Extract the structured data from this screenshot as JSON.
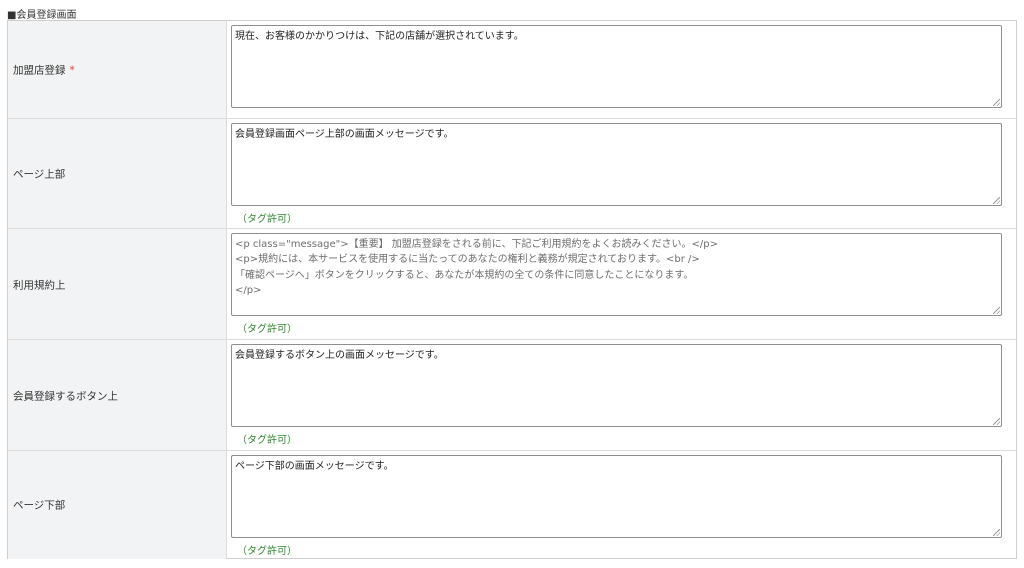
{
  "section": {
    "title": "■会員登録画面"
  },
  "rows": [
    {
      "label": "加盟店登録",
      "required_mark": "*",
      "value": "現在、お客様のかかりつけは、下記の店舗が選択されています。",
      "hint": ""
    },
    {
      "label": "ページ上部",
      "value": "会員登録画面ページ上部の画面メッセージです。",
      "hint": "（タグ許可）"
    },
    {
      "label": "利用規約上",
      "value": "<p class=\"message\">【重要】 加盟店登録をされる前に、下記ご利用規約をよくお読みください。</p>\n<p>規約には、本サービスを使用するに当たってのあなたの権利と義務が規定されております。<br />\n「確認ページへ」ボタンをクリックすると、あなたが本規約の全ての条件に同意したことになります。\n</p>",
      "hint": "（タグ許可）"
    },
    {
      "label": "会員登録するボタン上",
      "value": "会員登録するボタン上の画面メッセージです。",
      "hint": "（タグ許可）"
    },
    {
      "label": "ページ下部",
      "value": "ページ下部の画面メッセージです。",
      "hint": "（タグ許可）"
    }
  ],
  "colors": {
    "required": "#e23a3a",
    "hint": "#2f8a2f",
    "label_bg": "#f2f3f4",
    "border": "#dcdcdc"
  }
}
